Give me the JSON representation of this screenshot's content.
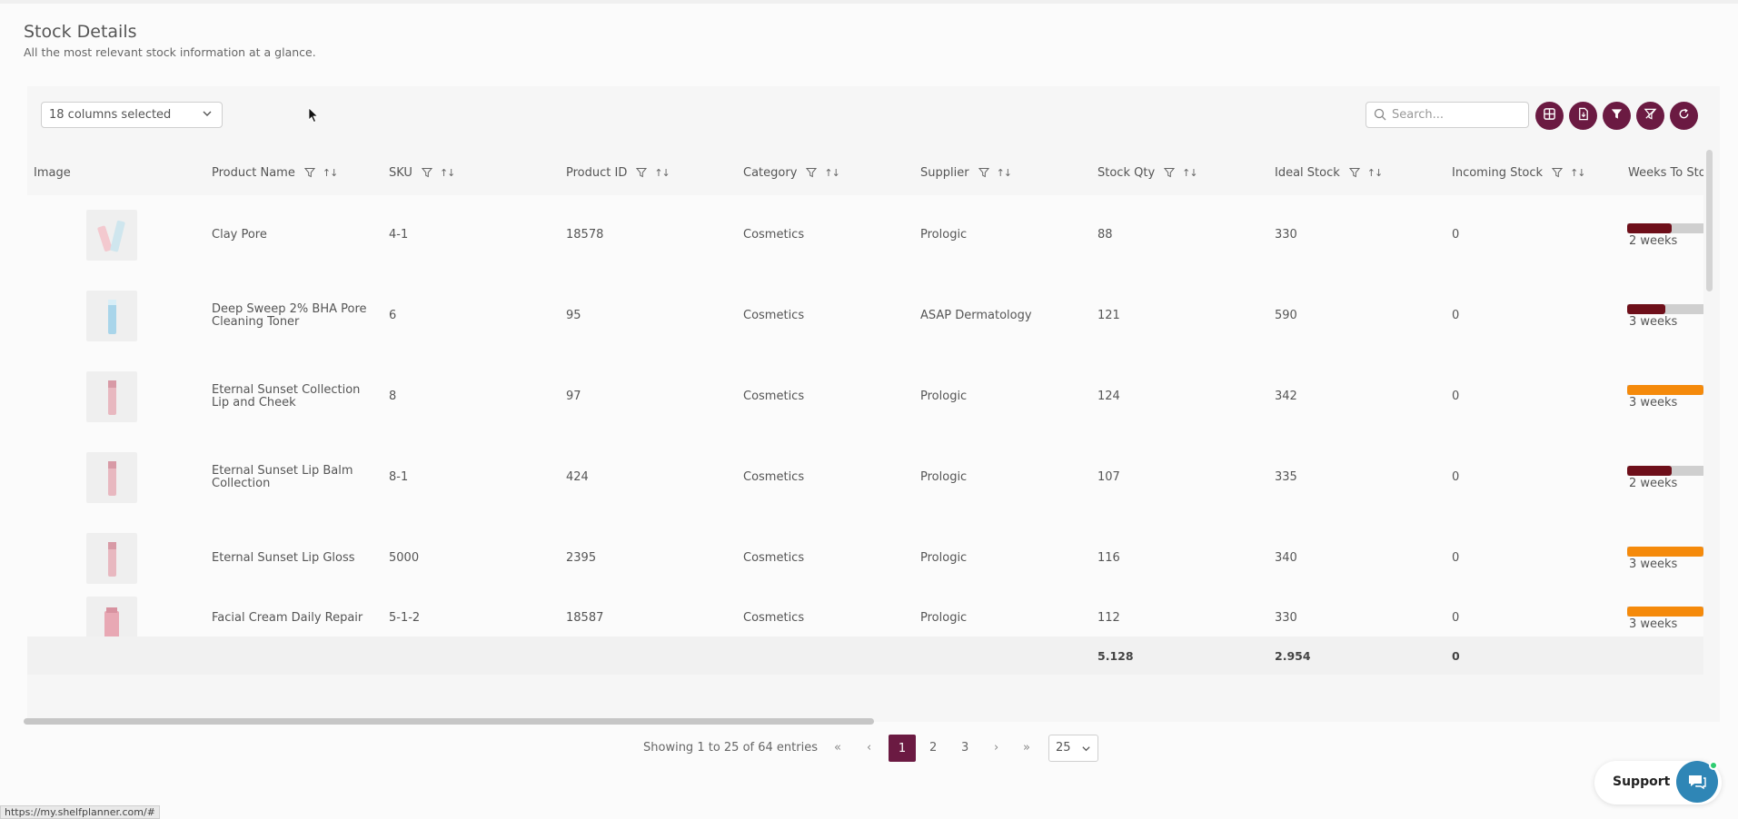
{
  "page": {
    "title": "Stock Details",
    "subtitle": "All the most relevant stock information at a glance."
  },
  "toolbar": {
    "columns_selected": "18 columns selected",
    "search_placeholder": "Search...",
    "buttons": [
      "grid-view-icon",
      "export-file-icon",
      "filter-icon",
      "clear-filter-icon",
      "refresh-icon"
    ],
    "accent": "#6b1a42"
  },
  "table": {
    "columns": [
      "Image",
      "Product Name",
      "SKU",
      "Product ID",
      "Category",
      "Supplier",
      "Stock Qty",
      "Ideal Stock",
      "Incoming Stock",
      "Weeks To Sto"
    ],
    "rows": [
      {
        "name": "Clay Pore",
        "sku": "4-1",
        "product_id": "18578",
        "category": "Cosmetics",
        "supplier": "Prologic",
        "stock_qty": "88",
        "ideal_stock": "330",
        "incoming": "0",
        "weeks": "2 weeks",
        "weeks_level": 0.58,
        "bar_color": "#6e0f1a"
      },
      {
        "name": "Deep Sweep 2% BHA Pore Cleaning Toner",
        "sku": "6",
        "product_id": "95",
        "category": "Cosmetics",
        "supplier": "ASAP Dermatology",
        "stock_qty": "121",
        "ideal_stock": "590",
        "incoming": "0",
        "weeks": "3 weeks",
        "weeks_level": 0.5,
        "bar_color": "#6e0f1a"
      },
      {
        "name": "Eternal Sunset Collection Lip and Cheek",
        "sku": "8",
        "product_id": "97",
        "category": "Cosmetics",
        "supplier": "Prologic",
        "stock_qty": "124",
        "ideal_stock": "342",
        "incoming": "0",
        "weeks": "3 weeks",
        "weeks_level": 1.0,
        "bar_color": "#f58a0b"
      },
      {
        "name": "Eternal Sunset Lip Balm Collection",
        "sku": "8-1",
        "product_id": "424",
        "category": "Cosmetics",
        "supplier": "Prologic",
        "stock_qty": "107",
        "ideal_stock": "335",
        "incoming": "0",
        "weeks": "2 weeks",
        "weeks_level": 0.58,
        "bar_color": "#6e0f1a"
      },
      {
        "name": "Eternal Sunset Lip Gloss",
        "sku": "5000",
        "product_id": "2395",
        "category": "Cosmetics",
        "supplier": "Prologic",
        "stock_qty": "116",
        "ideal_stock": "340",
        "incoming": "0",
        "weeks": "3 weeks",
        "weeks_level": 1.0,
        "bar_color": "#f58a0b"
      },
      {
        "name": "Facial Cream Daily Repair",
        "sku": "5-1-2",
        "product_id": "18587",
        "category": "Cosmetics",
        "supplier": "Prologic",
        "stock_qty": "112",
        "ideal_stock": "330",
        "incoming": "0",
        "weeks": "3 weeks",
        "weeks_level": 1.0,
        "bar_color": "#f58a0b"
      }
    ],
    "totals": {
      "stock_qty": "5.128",
      "ideal_stock": "2.954",
      "incoming": "0"
    }
  },
  "pagination": {
    "info": "Showing 1 to 25 of 64 entries",
    "first": "«",
    "prev": "‹",
    "pages": [
      "1",
      "2",
      "3"
    ],
    "current": "1",
    "next": "›",
    "last": "»",
    "page_size": "25"
  },
  "support": {
    "label": "Support"
  },
  "status_url": "https://my.shelfplanner.com/#"
}
